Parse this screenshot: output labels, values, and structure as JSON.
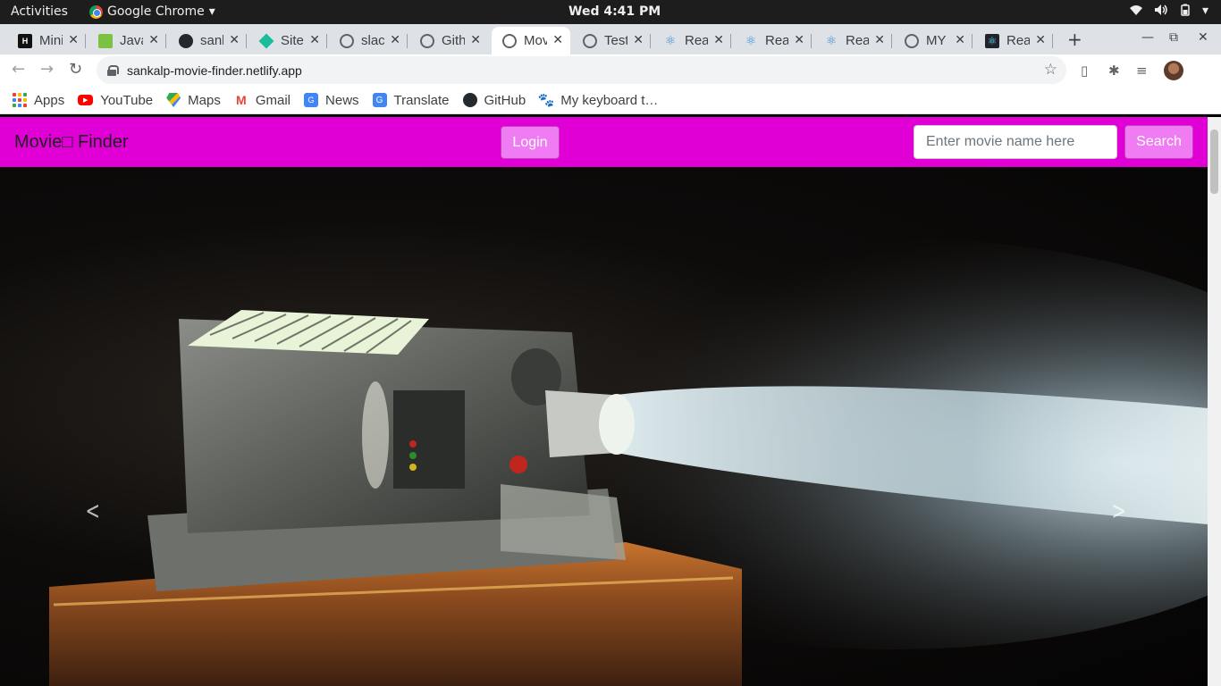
{
  "system": {
    "activities": "Activities",
    "app_name": "Google Chrome",
    "clock": "Wed  4:41 PM"
  },
  "tabs": [
    {
      "title": "Mini",
      "icon": "hackerrank-icon"
    },
    {
      "title": "Java",
      "icon": "java-icon"
    },
    {
      "title": "sank",
      "icon": "github-icon"
    },
    {
      "title": "Site",
      "icon": "netlify-icon"
    },
    {
      "title": "slac",
      "icon": "globe-icon"
    },
    {
      "title": "Gith",
      "icon": "globe-icon"
    },
    {
      "title": "Mov",
      "icon": "globe-icon",
      "active": true
    },
    {
      "title": "Test",
      "icon": "globe-icon"
    },
    {
      "title": "Rea",
      "icon": "react-icon"
    },
    {
      "title": "Rea",
      "icon": "react-icon"
    },
    {
      "title": "Rea",
      "icon": "react-icon"
    },
    {
      "title": "MY",
      "icon": "globe-icon"
    },
    {
      "title": "Rea",
      "icon": "react-icon"
    }
  ],
  "address_bar": {
    "url": "sankalp-movie-finder.netlify.app"
  },
  "bookmarks": {
    "apps": "Apps",
    "youtube": "YouTube",
    "maps": "Maps",
    "gmail": "Gmail",
    "news": "News",
    "translate": "Translate",
    "github": "GitHub",
    "keyboard": "My keyboard t…"
  },
  "site": {
    "brand": "Movie□ Finder",
    "login_label": "Login",
    "search_placeholder": "Enter movie name here",
    "search_label": "Search"
  },
  "colors": {
    "navbar": "#e000d5",
    "button": "#f07cf3"
  }
}
